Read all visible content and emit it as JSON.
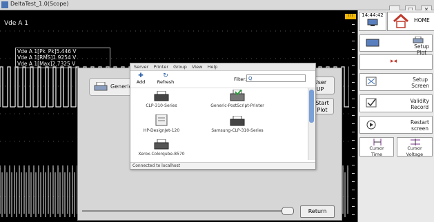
{
  "window": {
    "title": "DeltaTest_1.0(Scope)",
    "controls": [
      "_",
      "□",
      "×"
    ]
  },
  "scope": {
    "title": "Vde A 1",
    "measurements": [
      "Vde A 1[Pk_Pk]5.446 V",
      "Vde A 1[RMS]1.9254 V",
      "Vde A 1[Max]2.7325 V"
    ]
  },
  "modal": {
    "generic_label": "Generic",
    "user_label": "User\nUP",
    "start_label": "Start\nPlot",
    "return_label": "Return",
    "slider_value": 0.97
  },
  "printer_dialog": {
    "menu": [
      "Server",
      "Printer",
      "Group",
      "View",
      "Help"
    ],
    "toolbar": {
      "add": "Add",
      "refresh": "Refresh",
      "filter_label": "Filter:",
      "filter_value": "Q"
    },
    "printers": [
      "CLP-310-Series",
      "Generic-PostScript-Printer",
      "HP-DesignJet-120",
      "Samsung-CLP-310-Series",
      "Xerox-Colorqube-8570"
    ],
    "status": "Connected to localhost"
  },
  "sidebar": {
    "time": "14:44:42",
    "home_label": "HOME",
    "warning_badge": "!!!",
    "buttons": [
      {
        "id": "setup-plot",
        "label": "Setup\nPlot"
      },
      {
        "id": "toggle",
        "label": ""
      },
      {
        "id": "setup-screen",
        "label": "Setup\nScreen"
      },
      {
        "id": "validity-record",
        "label": "Validity\nRecord"
      },
      {
        "id": "restart-screen",
        "label": "Restart\nscreen"
      }
    ],
    "cursor_time": "Cursor\nTime",
    "cursor_voltage": "Cursor\nVoltage"
  },
  "colors": {
    "scope_bg": "#000000",
    "trace": "#e6e6e6",
    "accent": "#2a5ea8",
    "highlight": "#f2b705"
  }
}
